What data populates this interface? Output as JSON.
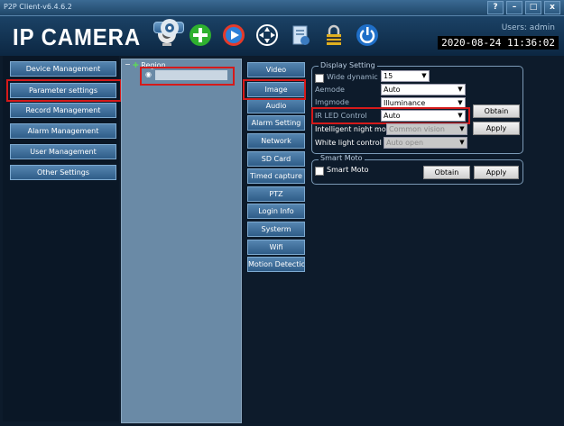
{
  "window": {
    "title": "P2P Client-v6.4.6.2",
    "buttons": [
      "?",
      "–",
      "□",
      "x"
    ]
  },
  "header": {
    "logo": "IP CAMERA",
    "users": "Users: admin",
    "datetime": "2020-08-24 11:36:02",
    "toolbar_icons": [
      "camera-icon",
      "add-icon",
      "playback-icon",
      "ptz-icon",
      "settings-icon",
      "file-icon",
      "lock-icon",
      "power-icon"
    ]
  },
  "nav": [
    "Device Management",
    "Parameter settings",
    "Record Management",
    "Alarm Management",
    "User Management",
    "Other Settings"
  ],
  "tree": {
    "root": "Region"
  },
  "tabs": [
    "Video",
    "Image",
    "Audio",
    "Alarm Setting",
    "Network",
    "SD Card",
    "Timed capture",
    "PTZ",
    "Login Info",
    "Systerm",
    "Wifi",
    "Motion Detection"
  ],
  "display": {
    "legend": "Display Setting",
    "wide_dynamic": "Wide dynamic",
    "wide_value": "15",
    "aemode": "Aemode",
    "aemode_value": "Auto",
    "imgmode": "Imgmode",
    "imgmode_value": "Illuminance",
    "ir": "IR LED Control",
    "ir_value": "Auto",
    "night": "Intelligent night mode",
    "night_value": "Common vision",
    "white": "White light control",
    "white_value": "Auto open",
    "obtain": "Obtain",
    "apply": "Apply"
  },
  "smart": {
    "legend": "Smart Moto",
    "label": "Smart Moto",
    "obtain": "Obtain",
    "apply": "Apply"
  },
  "colors": {
    "highlight": "#d51a1a",
    "bg": "#0d1b2b",
    "button": "#3f6f9a"
  }
}
